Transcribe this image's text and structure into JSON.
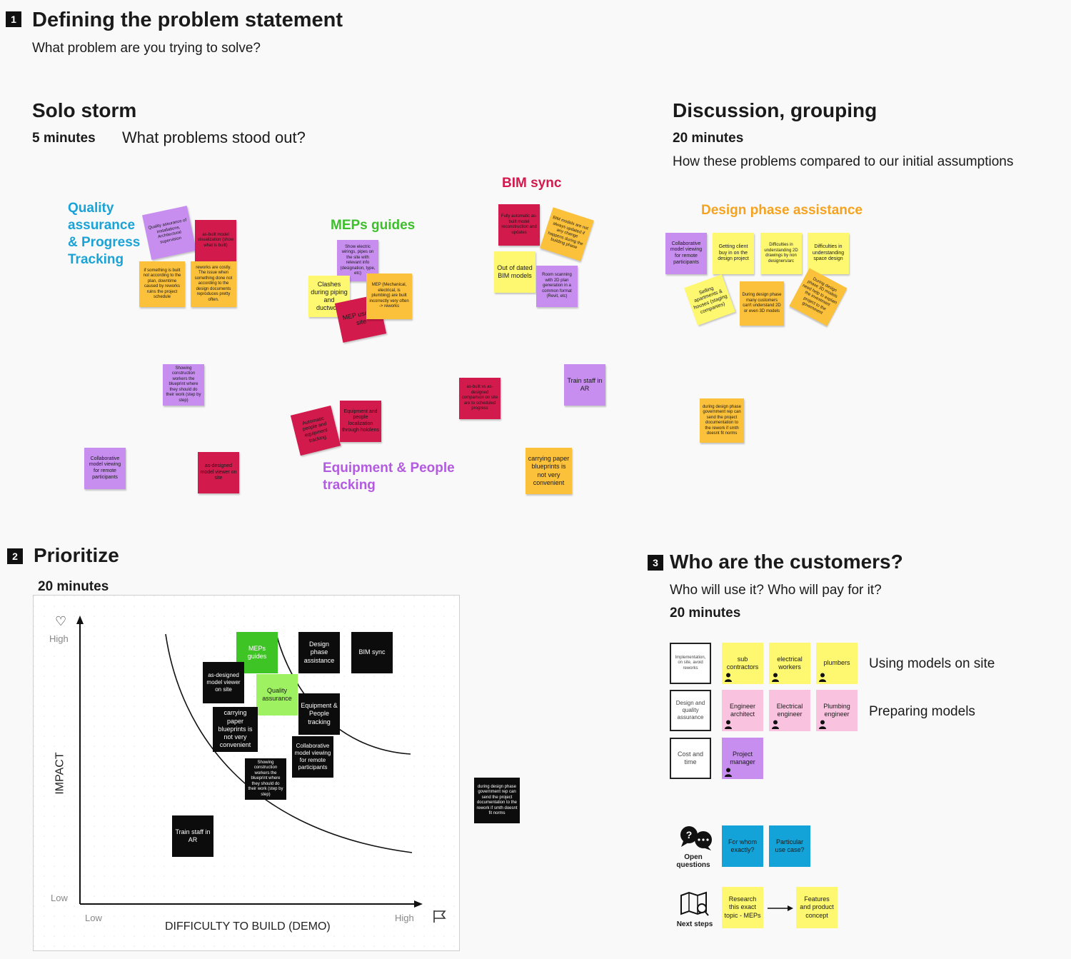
{
  "section1": {
    "number": "1",
    "title": "Defining the problem statement",
    "subtitle": "What problem are you trying to solve?"
  },
  "solo_storm": {
    "title": "Solo storm",
    "duration": "5 minutes",
    "question": "What problems stood out?",
    "clusters": {
      "quality": "Quality assurance & Progress Tracking",
      "meps": "MEPs guides",
      "bim": "BIM sync",
      "equipment": "Equipment & People tracking"
    },
    "notes": {
      "qa1": "Quality assurance of installations, Architectural supervision",
      "qa2": "as-built model visualization (show what is built)",
      "qa3": "if something is built not according to the plan, downtime caused by reworks ruins the project schedule",
      "qa4": "reworks are costly. The issue when something done not according to the design documents reproduces pretty often.",
      "mep1": "Show electric wirings, pipes on the site with relevant info (designation, type, etc)",
      "mep2": "Clashes during piping and ductwork",
      "mep3": "MEP (Mechanical, electrical, is plumbing) are built incorrectly very often -> reworks",
      "mep4": "MEP use on site",
      "bim1": "Fully automatic as-built model reconstruction and updates",
      "bim2": "BIM models are not always updated if any change happens during the building phase",
      "bim3": "Out of dated BIM models",
      "bim4": "Room scanning with 2D plan generation in a common format (Revit, etc)",
      "s1": "Showing construction workers the blueprint where they should do their work (step by step)",
      "s2": "Collaborative model viewing for remote participants",
      "s3": "as-designed model viewer on site",
      "eq1": "Automatic people and equipment tracking",
      "eq2": "Equipment and people localization through hololens",
      "s4": "as-built vs as-designed comparison on site are to scheduled progress",
      "s5": "Train staff in AR",
      "s6": "carrying paper blueprints is not very convenient"
    }
  },
  "discussion": {
    "title": "Discussion, grouping",
    "duration": "20 minutes",
    "question": "How these problems compared to our initial assumptions",
    "cluster": "Design phase assistance",
    "notes": {
      "d1": "Collaborative model viewing for remote participants",
      "d2": "Getting client buy in on the design project",
      "d3": "Difficulties in understanding 2D drawings by non designers/arc",
      "d4": "Difficulties in understanding space design",
      "d5": "Selling apartments & houses (staging companies)",
      "d6": "During design phase many customers can't understand 2D or even 3D models",
      "d7": "During design phase 3D models need help to explain the investment project to the government",
      "d8": "during design phase government rep can send the project documentation to the rework if smth doesnt fit norms"
    }
  },
  "prioritize": {
    "number": "2",
    "title": "Prioritize",
    "duration": "20 minutes",
    "y_high": "High",
    "y_low": "Low",
    "y_title": "IMPACT",
    "x_low": "Low",
    "x_high": "High",
    "x_title": "DIFFICULTY TO BUILD (DEMO)",
    "notes": {
      "meps": "MEPs guides",
      "design": "Design phase assistance",
      "bim": "BIM sync",
      "asdesigned": "as-designed model viewer on site",
      "quality": "Quality assurance",
      "equipment": "Equipment & People tracking",
      "paper": "carrying paper blueprints is not very convenient",
      "collab": "Collaborative model viewing for remote participants",
      "showing": "Showing construction workers the blueprint where they should do their work (step by step)",
      "train": "Train staff in AR",
      "outside": "during design phase government rep can send the project documentation to the rework if smth doesnt fit norms"
    }
  },
  "customers": {
    "number": "3",
    "title": "Who are the customers?",
    "subtitle": "Who will use it? Who will pay for it?",
    "duration": "20 minutes",
    "rows": [
      {
        "header": "Implementation, on site, avoid reworks",
        "cards": [
          "sub contractors",
          "electrical workers",
          "plumbers"
        ],
        "label": "Using models on site"
      },
      {
        "header": "Design and quality assurance",
        "cards": [
          "Engineer architect",
          "Electrical engineer",
          "Plumbing engineer"
        ],
        "label": "Preparing models"
      },
      {
        "header": "Cost and time",
        "cards": [
          "Project manager"
        ],
        "label": ""
      }
    ],
    "open_questions": {
      "label": "Open questions",
      "cards": [
        "For whom exactly?",
        "Particular use case?"
      ]
    },
    "next_steps": {
      "label": "Next steps",
      "cards": [
        "Research this exact topic - MEPs",
        "Features and product concept"
      ]
    }
  }
}
